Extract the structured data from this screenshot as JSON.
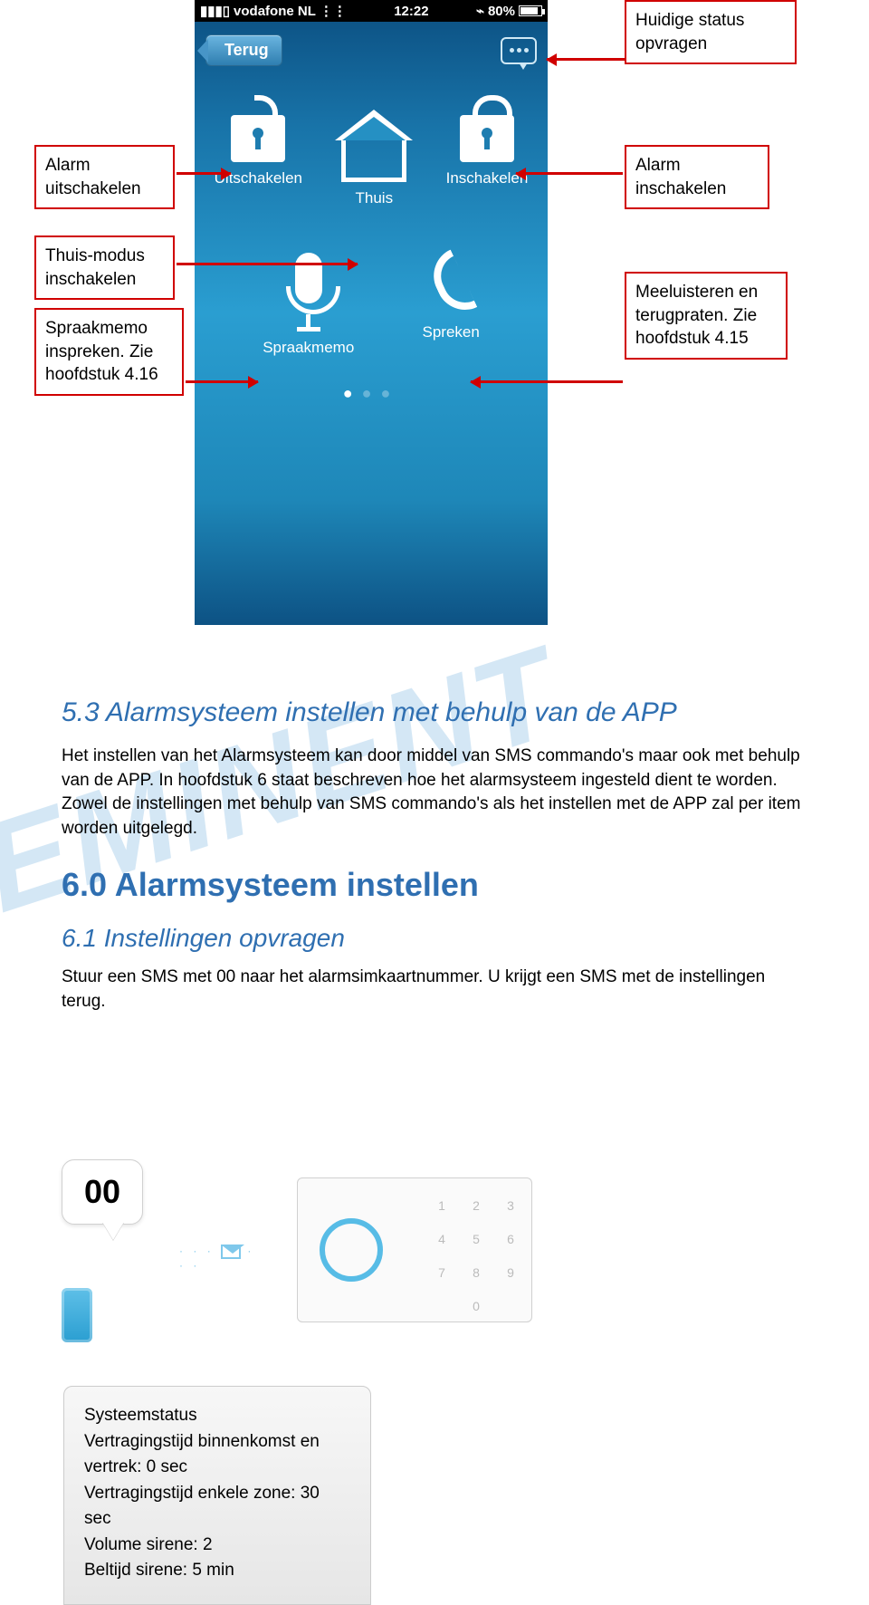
{
  "phone": {
    "carrier": "vodafone NL",
    "time": "12:22",
    "battery_pct": "80%",
    "back_label": "Terug",
    "icons": {
      "uitschakelen": "Uitschakelen",
      "thuis": "Thuis",
      "inschakelen": "Inschakelen",
      "spraakmemo": "Spraakmemo",
      "spreken": "Spreken"
    }
  },
  "callouts": {
    "top_right": "Huidige status opvragen",
    "left1": "Alarm uitschakelen",
    "left2": "Thuis-modus inschakelen",
    "left3": "Spraakmemo inspreken. Zie hoofdstuk 4.16",
    "right1": "Alarm inschakelen",
    "right2": "Meeluisteren en terugpraten. Zie hoofdstuk 4.15"
  },
  "section53": {
    "heading": "5.3 Alarmsysteem instellen met behulp van de APP",
    "para": "Het instellen van het Alarmsysteem kan door middel van SMS commando's maar ook met behulp van de APP. In hoofdstuk 6 staat beschreven hoe het alarmsysteem ingesteld dient te worden. Zowel de instellingen met behulp van SMS commando's als het instellen met de APP zal per item worden uitgelegd."
  },
  "section60": {
    "heading": "6.0 Alarmsysteem instellen"
  },
  "section61": {
    "heading": "6.1 Instellingen opvragen",
    "para": "Stuur een SMS met 00 naar het alarmsimkaartnummer. U krijgt een SMS met de instellingen terug."
  },
  "sms_code": "00",
  "keypad": [
    "1",
    "2",
    "3",
    "4",
    "5",
    "6",
    "7",
    "8",
    "9",
    "",
    "0",
    ""
  ],
  "result": {
    "title": "Systeemstatus",
    "l1": "Vertragingstijd binnenkomst en vertrek: 0 sec",
    "l2": "Vertragingstijd enkele zone: 30 sec",
    "l3": "Volume sirene: 2",
    "l4": "Beltijd sirene: 5 min"
  },
  "watermark": "EMINENT"
}
